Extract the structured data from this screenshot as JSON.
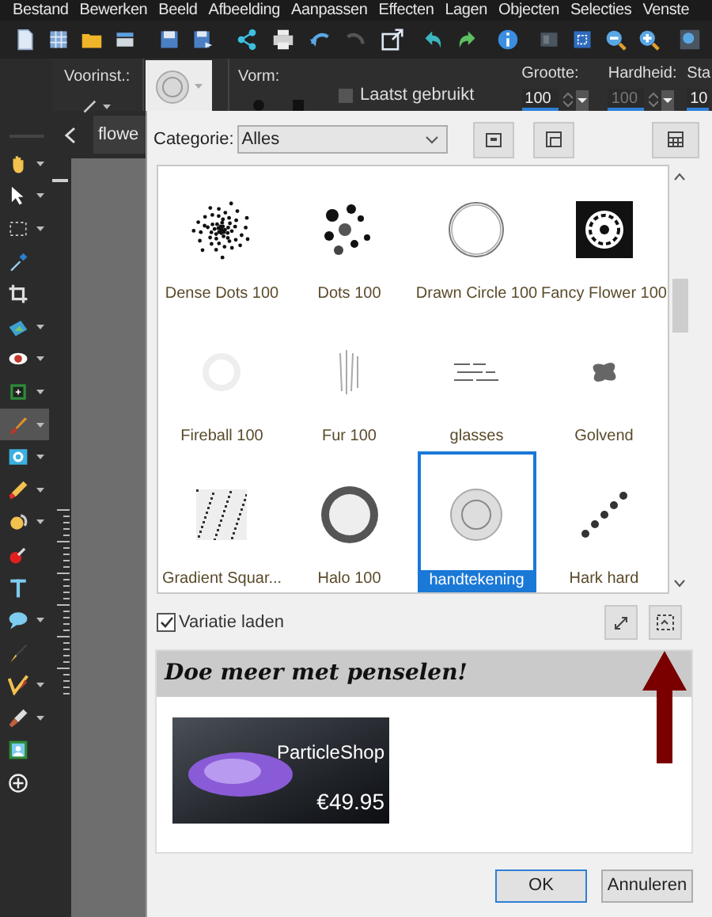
{
  "menu": [
    "Bestand",
    "Bewerken",
    "Beeld",
    "Afbeelding",
    "Aanpassen",
    "Effecten",
    "Lagen",
    "Objecten",
    "Selecties",
    "Venste"
  ],
  "options": {
    "preset_label": "Voorinst.:",
    "shape_label": "Vorm:",
    "recent": {
      "label": "Laatst gebruikt",
      "checked": false
    },
    "size": {
      "label": "Grootte:",
      "value": "100",
      "disabled": false
    },
    "hardness": {
      "label": "Hardheid:",
      "value": "100",
      "disabled": true
    },
    "step": {
      "label": "Sta",
      "value": "10"
    }
  },
  "tools": [
    {
      "selected": false
    },
    {
      "selected": false
    },
    {
      "selected": false
    },
    {
      "selected": false
    },
    {
      "selected": false
    },
    {
      "selected": false
    },
    {
      "selected": false
    },
    {
      "selected": false
    },
    {
      "selected": true
    },
    {
      "selected": false
    },
    {
      "selected": false
    },
    {
      "selected": false
    },
    {
      "selected": false
    },
    {
      "selected": false
    },
    {
      "selected": false
    },
    {
      "selected": false
    },
    {
      "selected": false
    },
    {
      "selected": false
    },
    {
      "selected": false
    },
    {
      "selected": false
    }
  ],
  "document_tab": {
    "label": "flowe"
  },
  "dialog": {
    "category_label": "Categorie:",
    "category": "Alles",
    "brushes": [
      {
        "label": "Dense Dots 100",
        "selected": false
      },
      {
        "label": "Dots 100",
        "selected": false
      },
      {
        "label": "Drawn Circle 100",
        "selected": false
      },
      {
        "label": "Fancy Flower 100",
        "selected": false
      },
      {
        "label": "Fireball 100",
        "selected": false
      },
      {
        "label": "Fur 100",
        "selected": false
      },
      {
        "label": "glasses",
        "selected": false
      },
      {
        "label": "Golvend",
        "selected": false
      },
      {
        "label": "Gradient Squar...",
        "selected": false
      },
      {
        "label": "Halo 100",
        "selected": false
      },
      {
        "label": "handtekening",
        "selected": true
      },
      {
        "label": "Hark hard",
        "selected": false
      }
    ],
    "variation": {
      "label": "Variatie laden",
      "checked": true
    },
    "promo": {
      "heading": "Doe meer met penselen!",
      "banner_title": "ParticleShop",
      "price": "€49.95"
    },
    "buttons": [
      {
        "label": "OK",
        "default": true
      },
      {
        "label": "Annuleren",
        "default": false
      }
    ]
  }
}
